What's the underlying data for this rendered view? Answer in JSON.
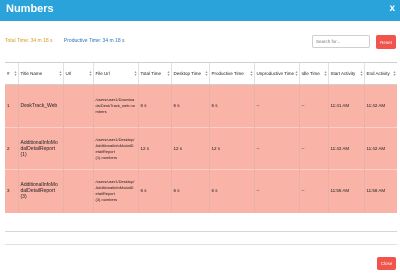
{
  "header": {
    "title": "Numbers",
    "close_glyph": "x"
  },
  "stats": {
    "total_time": "Total Time: 34 m 18 s",
    "productive_time": "Productive Time: 34 m 18 s",
    "total_color": "#d59b1b",
    "productive_color": "#2b6fb7"
  },
  "search": {
    "placeholder": "Search for...",
    "value": ""
  },
  "reset_label": "Reset",
  "table": {
    "columns": [
      "#",
      "Title Name",
      "Url",
      "File Url",
      "Total Time",
      "Desktop Time",
      "Productive Time",
      "Unproductive Time",
      "Idle Time",
      "Start Activity",
      "End Activity"
    ],
    "rows": [
      [
        "1",
        "DeskTrack_Web",
        "",
        "/users/user1/Downloads/DeskTrack_web.numbers",
        "6 s",
        "6 s",
        "6 s",
        "--",
        "--",
        "11:41 AM",
        "11:42 AM"
      ],
      [
        "2",
        "AdditionalInfoModalDetailReport (1)",
        "",
        "/users/user1/Desktop/AdditionalInfoModalDetailReport (1).numbers",
        "12 s",
        "12 s",
        "12 s",
        "--",
        "--",
        "11:42 AM",
        "11:42 AM"
      ],
      [
        "3",
        "AdditionalInfoModalDetailReport (3)",
        "",
        "/users/user1/Desktop/AdditionalInfoModalDetailReport (3).numbers",
        "6 s",
        "6 s",
        "6 s",
        "--",
        "--",
        "11:55 AM",
        "11:58 AM"
      ]
    ],
    "row_color": "#f9b3a7"
  },
  "footer": {
    "close_label": "Close"
  },
  "colors": {
    "header": "#2aa3db",
    "danger": "#f0544c"
  }
}
